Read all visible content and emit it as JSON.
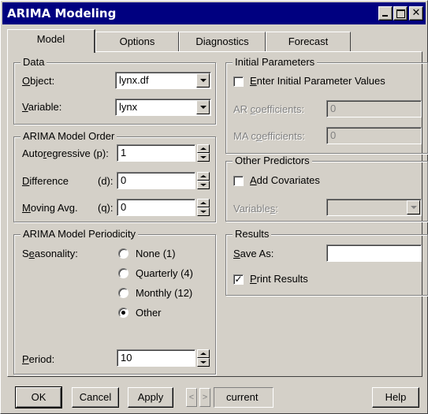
{
  "window": {
    "title": "ARIMA Modeling"
  },
  "tabs": [
    {
      "label": "Model",
      "active": true
    },
    {
      "label": "Options",
      "active": false
    },
    {
      "label": "Diagnostics",
      "active": false
    },
    {
      "label": "Forecast",
      "active": false
    }
  ],
  "data_group": {
    "legend": "Data",
    "object_label": "Object:",
    "object_value": "lynx.df",
    "variable_label": "Variable:",
    "variable_value": "lynx"
  },
  "order_group": {
    "legend": "ARIMA Model Order",
    "ar_label": "Autoregressive (p):",
    "ar_value": "1",
    "diff_label": "Difference",
    "diff_code": "(d):",
    "diff_value": "0",
    "ma_label": "Moving Avg.",
    "ma_code": "(q):",
    "ma_value": "0"
  },
  "periodicity_group": {
    "legend": "ARIMA Model Periodicity",
    "seasonality_label": "Seasonality:",
    "options": [
      "None (1)",
      "Quarterly (4)",
      "Monthly (12)",
      "Other"
    ],
    "selected": "Other",
    "period_label": "Period:",
    "period_value": "10"
  },
  "initial_params_group": {
    "legend": "Initial Parameters",
    "enter_label": "Enter Initial Parameter Values",
    "enter_checked": false,
    "ar_coef_label": "AR coefficients:",
    "ar_coef_value": "0",
    "ma_coef_label": "MA coefficients:",
    "ma_coef_value": "0"
  },
  "predictors_group": {
    "legend": "Other Predictors",
    "add_cov_label": "Add Covariates",
    "add_cov_checked": false,
    "variables_label": "Variables:",
    "variables_value": ""
  },
  "results_group": {
    "legend": "Results",
    "save_as_label": "Save As:",
    "save_as_value": "",
    "print_label": "Print Results",
    "print_checked": true
  },
  "footer": {
    "ok": "OK",
    "cancel": "Cancel",
    "apply": "Apply",
    "prev": "<",
    "next": ">",
    "current": "current",
    "help": "Help"
  }
}
